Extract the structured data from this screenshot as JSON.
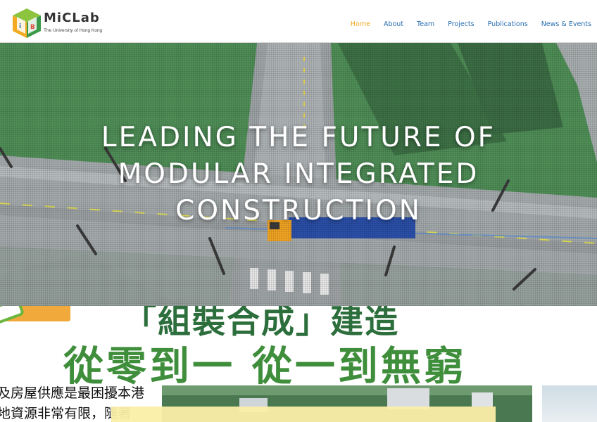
{
  "header": {
    "logo": {
      "name": "MiCLab",
      "subtitle": "The University of Hong Kong",
      "icon": "cube-logo-icon"
    },
    "nav": [
      {
        "label": "Home",
        "active": true
      },
      {
        "label": "About",
        "active": false
      },
      {
        "label": "Team",
        "active": false
      },
      {
        "label": "Projects",
        "active": false
      },
      {
        "label": "Publications",
        "active": false
      },
      {
        "label": "News & Events",
        "active": false
      }
    ]
  },
  "hero": {
    "title_line1": "LEADING THE FUTURE OF",
    "title_line2": "MODULAR INTEGRATED",
    "title_line3": "CONSTRUCTION"
  },
  "news": {
    "headline_top": "「組裝合成」建造",
    "headline_main": "從零到一  從一到無窮",
    "body_line1": "及房屋供應是最困擾本港",
    "body_line2": "地資源非常有限，隨著"
  },
  "colors": {
    "nav_link": "#2a6fb0",
    "nav_active": "#f3a920",
    "headline_dark_green": "#2c6e3c",
    "headline_green": "#3f8e3b"
  }
}
